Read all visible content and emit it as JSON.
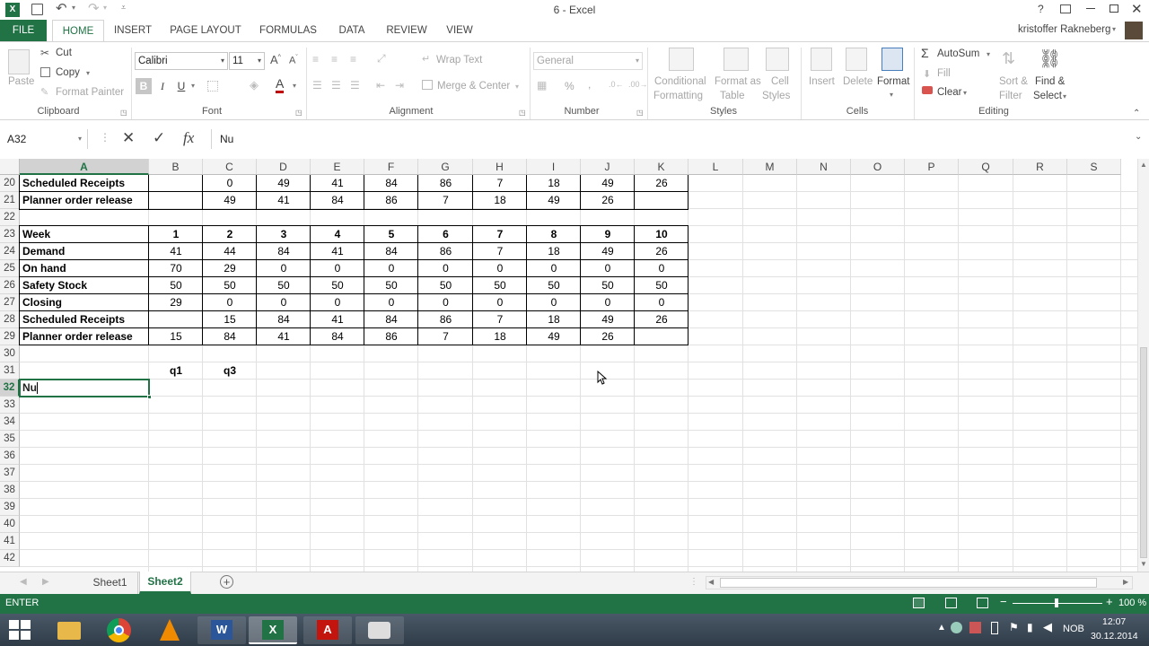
{
  "app": {
    "title": "6 - Excel",
    "user": "kristoffer Rakneberg",
    "help": "?"
  },
  "tabs": [
    {
      "label": "FILE"
    },
    {
      "label": "HOME"
    },
    {
      "label": "INSERT"
    },
    {
      "label": "PAGE LAYOUT"
    },
    {
      "label": "FORMULAS"
    },
    {
      "label": "DATA"
    },
    {
      "label": "REVIEW"
    },
    {
      "label": "VIEW"
    }
  ],
  "ribbon": {
    "clipboard": {
      "paste": "Paste",
      "cut": "Cut",
      "copy": "Copy",
      "format_painter": "Format Painter",
      "label": "Clipboard"
    },
    "font": {
      "name": "Calibri",
      "size": "11",
      "bold": "B",
      "italic": "I",
      "underline": "U",
      "label": "Font"
    },
    "alignment": {
      "wrap": "Wrap Text",
      "merge": "Merge & Center",
      "label": "Alignment"
    },
    "number": {
      "format": "General",
      "percent": "%",
      "comma": ",",
      "label": "Number"
    },
    "styles": {
      "conditional": "Conditional",
      "conditional2": "Formatting",
      "format_table": "Format as",
      "format_table2": "Table",
      "cell_styles": "Cell",
      "cell_styles2": "Styles",
      "label": "Styles"
    },
    "cells": {
      "insert": "Insert",
      "delete": "Delete",
      "format": "Format",
      "label": "Cells"
    },
    "editing": {
      "autosum": "AutoSum",
      "fill": "Fill",
      "clear": "Clear",
      "sort": "Sort &",
      "sort2": "Filter",
      "find": "Find &",
      "find2": "Select",
      "label": "Editing"
    }
  },
  "formula_bar": {
    "name_box": "A32",
    "content": "Nu",
    "fx": "fx"
  },
  "columns": [
    "A",
    "B",
    "C",
    "D",
    "E",
    "F",
    "G",
    "H",
    "I",
    "J",
    "K",
    "L",
    "M",
    "N",
    "O",
    "P",
    "Q",
    "R",
    "S"
  ],
  "rows": [
    "20",
    "21",
    "22",
    "23",
    "24",
    "25",
    "26",
    "27",
    "28",
    "29",
    "30",
    "31",
    "32",
    "33",
    "34",
    "35",
    "36",
    "37",
    "38",
    "39",
    "40",
    "41",
    "42"
  ],
  "table1": {
    "scheduled_label": "Scheduled Receipts",
    "scheduled": [
      "",
      "0",
      "49",
      "41",
      "84",
      "86",
      "7",
      "18",
      "49",
      "26"
    ],
    "planner_label": "Planner order release",
    "planner": [
      "",
      "49",
      "41",
      "84",
      "86",
      "7",
      "18",
      "49",
      "26",
      ""
    ]
  },
  "table2": {
    "week_label": "Week",
    "week": [
      "1",
      "2",
      "3",
      "4",
      "5",
      "6",
      "7",
      "8",
      "9",
      "10"
    ],
    "demand_label": "Demand",
    "demand": [
      "41",
      "44",
      "84",
      "41",
      "84",
      "86",
      "7",
      "18",
      "49",
      "26"
    ],
    "onhand_label": "On hand",
    "onhand": [
      "70",
      "29",
      "0",
      "0",
      "0",
      "0",
      "0",
      "0",
      "0",
      "0"
    ],
    "safety_label": "Safety Stock",
    "safety": [
      "50",
      "50",
      "50",
      "50",
      "50",
      "50",
      "50",
      "50",
      "50",
      "50"
    ],
    "closing_label": "Closing",
    "closing": [
      "29",
      "0",
      "0",
      "0",
      "0",
      "0",
      "0",
      "0",
      "0",
      "0"
    ],
    "scheduled_label": "Scheduled Receipts",
    "scheduled": [
      "",
      "15",
      "84",
      "41",
      "84",
      "86",
      "7",
      "18",
      "49",
      "26"
    ],
    "planner_label": "Planner order release",
    "planner": [
      "15",
      "84",
      "41",
      "84",
      "86",
      "7",
      "18",
      "49",
      "26",
      ""
    ]
  },
  "q_labels": {
    "q1": "q1",
    "q3": "q3"
  },
  "active_cell_value": "Nu",
  "sheets": [
    {
      "label": "Sheet1"
    },
    {
      "label": "Sheet2"
    }
  ],
  "status": {
    "mode": "ENTER",
    "zoom": "100 %"
  },
  "taskbar": {
    "lang": "NOB",
    "time": "12:07",
    "date": "30.12.2014"
  },
  "colors": {
    "accent": "#217346",
    "active_tab": "#217346"
  }
}
